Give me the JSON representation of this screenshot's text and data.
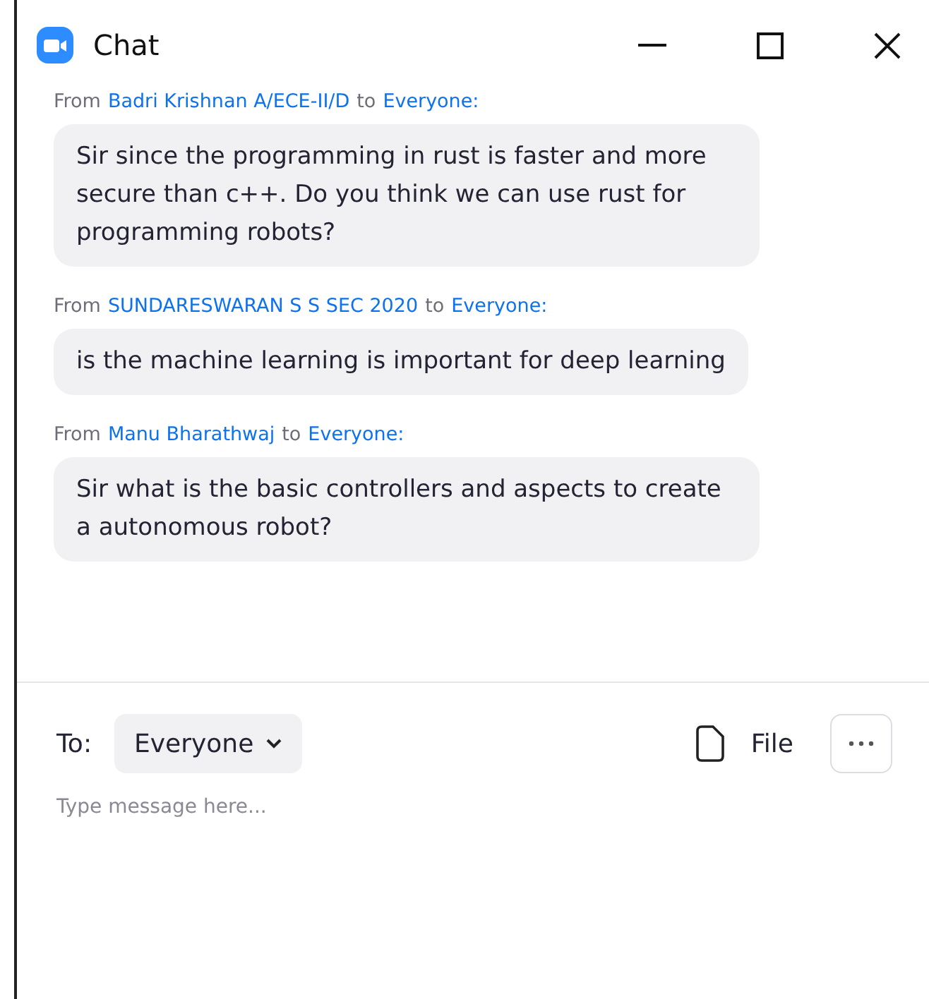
{
  "window": {
    "title": "Chat"
  },
  "messages": [
    {
      "from_label": "From",
      "sender": "Badri Krishnan A/ECE-II/D",
      "to_label": "to",
      "recipient": "Everyone:",
      "text": "Sir since the programming in rust is faster and more secure than c++. Do you think we can use rust for programming robots?"
    },
    {
      "from_label": "From",
      "sender": "SUNDARESWARAN S S SEC 2020",
      "to_label": "to",
      "recipient": "Everyone:",
      "text": "is the machine learning is important for deep learning"
    },
    {
      "from_label": "From",
      "sender": "Manu Bharathwaj",
      "to_label": "to",
      "recipient": "Everyone:",
      "text": "Sir what is the basic controllers and aspects to create a autonomous robot?"
    }
  ],
  "composer": {
    "to_label": "To:",
    "recipient": "Everyone",
    "file_label": "File",
    "placeholder": "Type message here..."
  }
}
